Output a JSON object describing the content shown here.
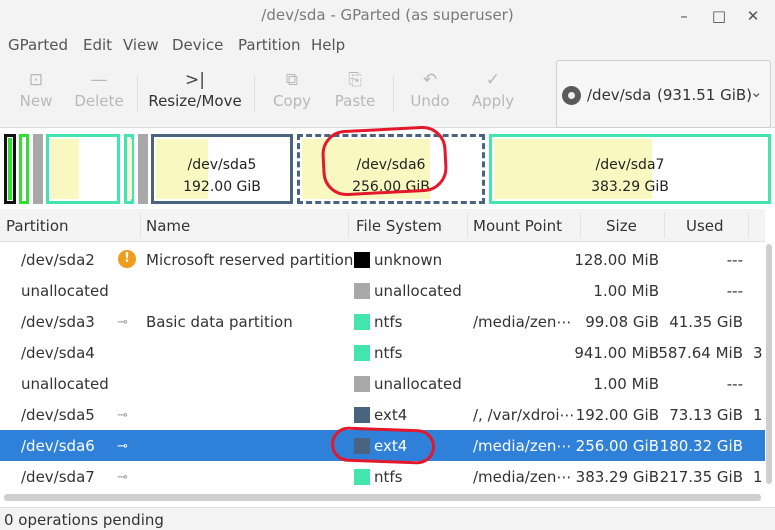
{
  "window": {
    "title": "/dev/sda - GParted (as superuser)",
    "minimize_glyph": "–",
    "maximize_glyph": "□",
    "close_glyph": "✕"
  },
  "menubar": {
    "items": [
      "GParted",
      "Edit",
      "View",
      "Device",
      "Partition",
      "Help"
    ]
  },
  "toolbar": {
    "new": {
      "label": "New",
      "icon": "new-partition-icon",
      "glyph": "⊡"
    },
    "delete": {
      "label": "Delete",
      "icon": "delete-icon",
      "glyph": "—"
    },
    "resize": {
      "label": "Resize/Move",
      "icon": "resize-move-icon",
      "glyph": ">|"
    },
    "copy": {
      "label": "Copy",
      "icon": "copy-icon",
      "glyph": "⧉"
    },
    "paste": {
      "label": "Paste",
      "icon": "paste-icon",
      "glyph": "⎘"
    },
    "undo": {
      "label": "Undo",
      "icon": "undo-icon",
      "glyph": "↶"
    },
    "apply": {
      "label": "Apply",
      "icon": "apply-icon",
      "glyph": "✓"
    }
  },
  "device_selector": {
    "device": "/dev/sda",
    "size": "(931.51 GiB)",
    "caret": "⌄"
  },
  "disk_map": {
    "sda5": {
      "name": "/dev/sda5",
      "size": "192.00 GiB"
    },
    "sda6": {
      "name": "/dev/sda6",
      "size": "256.00 GiB"
    },
    "sda7": {
      "name": "/dev/sda7",
      "size": "383.29 GiB"
    }
  },
  "table": {
    "columns": [
      "Partition",
      "Name",
      "File System",
      "Mount Point",
      "Size",
      "Used"
    ],
    "rows": [
      {
        "partition": "/dev/sda2",
        "name": "Microsoft reserved partition",
        "filesystem": "unknown",
        "mount": "",
        "size": "128.00 MiB",
        "used": "---",
        "extra": "",
        "badge": "warning",
        "warn_glyph": "!",
        "fs_color": "#000000"
      },
      {
        "partition": "unallocated",
        "name": "",
        "filesystem": "unallocated",
        "mount": "",
        "size": "1.00 MiB",
        "used": "---",
        "extra": "",
        "badge": "",
        "fs_color": "#a8a8a8"
      },
      {
        "partition": "/dev/sda3",
        "name": "Basic data partition",
        "filesystem": "ntfs",
        "mount": "/media/zen⋯",
        "size": "99.08 GiB",
        "used": "41.35 GiB",
        "extra": "",
        "badge": "key",
        "key_glyph": "⊸",
        "fs_color": "#42e5ac"
      },
      {
        "partition": "/dev/sda4",
        "name": "",
        "filesystem": "ntfs",
        "mount": "",
        "size": "941.00 MiB",
        "used": "587.64 MiB",
        "extra": "3",
        "badge": "",
        "fs_color": "#42e5ac"
      },
      {
        "partition": "unallocated",
        "name": "",
        "filesystem": "unallocated",
        "mount": "",
        "size": "1.00 MiB",
        "used": "---",
        "extra": "",
        "badge": "",
        "fs_color": "#a8a8a8"
      },
      {
        "partition": "/dev/sda5",
        "name": "",
        "filesystem": "ext4",
        "mount": "/, /var/xdroi⋯",
        "size": "192.00 GiB",
        "used": "73.13 GiB",
        "extra": "1",
        "badge": "key",
        "key_glyph": "⊸",
        "fs_color": "#4a6480"
      },
      {
        "partition": "/dev/sda6",
        "name": "",
        "filesystem": "ext4",
        "mount": "/media/zen⋯",
        "size": "256.00 GiB",
        "used": "180.32 GiB",
        "extra": "",
        "badge": "key",
        "key_glyph": "⊸",
        "fs_color": "#4a6480",
        "selected": true
      },
      {
        "partition": "/dev/sda7",
        "name": "",
        "filesystem": "ntfs",
        "mount": "/media/zen⋯",
        "size": "383.29 GiB",
        "used": "217.35 GiB",
        "extra": "1",
        "badge": "key",
        "key_glyph": "⊸",
        "fs_color": "#42e5ac"
      }
    ]
  },
  "status": {
    "text": "0 operations pending"
  },
  "colors": {
    "ext4": "#4a6480",
    "ntfs": "#42e5ac",
    "unallocated": "#a8a8a8",
    "selection": "#2f80d8",
    "annotation": "#e3182c"
  }
}
